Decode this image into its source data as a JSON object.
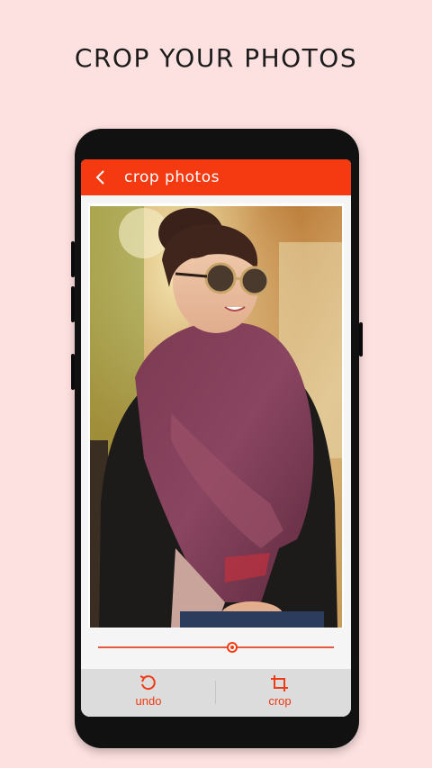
{
  "headline": "CROP YOUR PHOTOS",
  "appbar": {
    "title": "crop photos",
    "back_icon": "chevron-left-icon"
  },
  "photo": {
    "description_icon": "woman-portrait-photo"
  },
  "slider": {
    "value": 0.57
  },
  "toolbar": {
    "undo_label": "undo",
    "crop_label": "crop",
    "undo_icon": "undo-icon",
    "crop_icon": "crop-icon"
  },
  "colors": {
    "accent": "#f53a11",
    "background": "#fde0e0",
    "toolbar": "#dcdcdc"
  }
}
